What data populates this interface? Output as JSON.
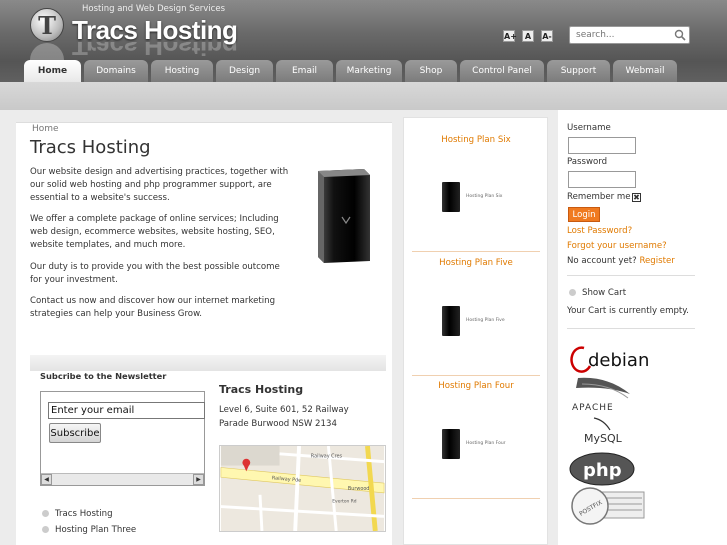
{
  "header": {
    "logo_letter": "T",
    "tagline": "Hosting and Web Design Services",
    "brand": "Tracs Hosting",
    "font_buttons": [
      "A+",
      "A",
      "A-"
    ],
    "search_placeholder": "search..."
  },
  "nav": {
    "tabs": [
      {
        "label": "Home",
        "active": true
      },
      {
        "label": "Domains"
      },
      {
        "label": "Hosting"
      },
      {
        "label": "Design"
      },
      {
        "label": "Email"
      },
      {
        "label": "Marketing"
      },
      {
        "label": "Shop"
      },
      {
        "label": "Control Panel"
      },
      {
        "label": "Support"
      },
      {
        "label": "Webmail"
      }
    ]
  },
  "main": {
    "breadcrumb": "Home",
    "title": "Tracs Hosting",
    "paragraphs": [
      "Our website design and advertising practices, together with our solid web hosting and php programmer support, are essential to a website's success.",
      "We offer a complete package of online services; Including web design, ecommerce websites, website hosting, SEO, website templates, and much more.",
      "Our duty is to provide you with the best possible outcome for your investment.",
      "Contact us now and discover how our internet marketing strategies can help your Business Grow."
    ],
    "newsletter": {
      "title": "Subcribe to the Newsletter",
      "email_value": "Enter your email",
      "button": "Subscribe"
    },
    "address": {
      "title": "Tracs Hosting",
      "text": "Level 6, Suite 601, 52 Railway Parade Burwood NSW 2134"
    },
    "map": {
      "streets": [
        "Railway Cres",
        "Railway Pde",
        "Burwood",
        "Everton Rd"
      ]
    },
    "links": [
      "Tracs Hosting",
      "Hosting Plan Three"
    ]
  },
  "plans": [
    {
      "title": "Hosting Plan Six",
      "caption": "Hosting Plan Six"
    },
    {
      "title": "Hosting Plan Five",
      "caption": "Hosting Plan Five"
    },
    {
      "title": "Hosting Plan Four",
      "caption": "Hosting Plan Four"
    }
  ],
  "login": {
    "username_label": "Username",
    "password_label": "Password",
    "remember_label": "Remember me",
    "remember_mark": "✖",
    "login_button": "Login",
    "lost_password": "Lost Password?",
    "forgot_username": "Forgot your username?",
    "no_account": "No account yet?",
    "register": "Register"
  },
  "cart": {
    "show_cart": "Show Cart",
    "empty_text": "Your Cart is currently empty."
  },
  "tech_logos": [
    "debian",
    "APACHE",
    "MySQL",
    "php",
    "POSTFIX"
  ],
  "colors": {
    "accent": "#e07a00",
    "login_button": "#f07a20"
  }
}
